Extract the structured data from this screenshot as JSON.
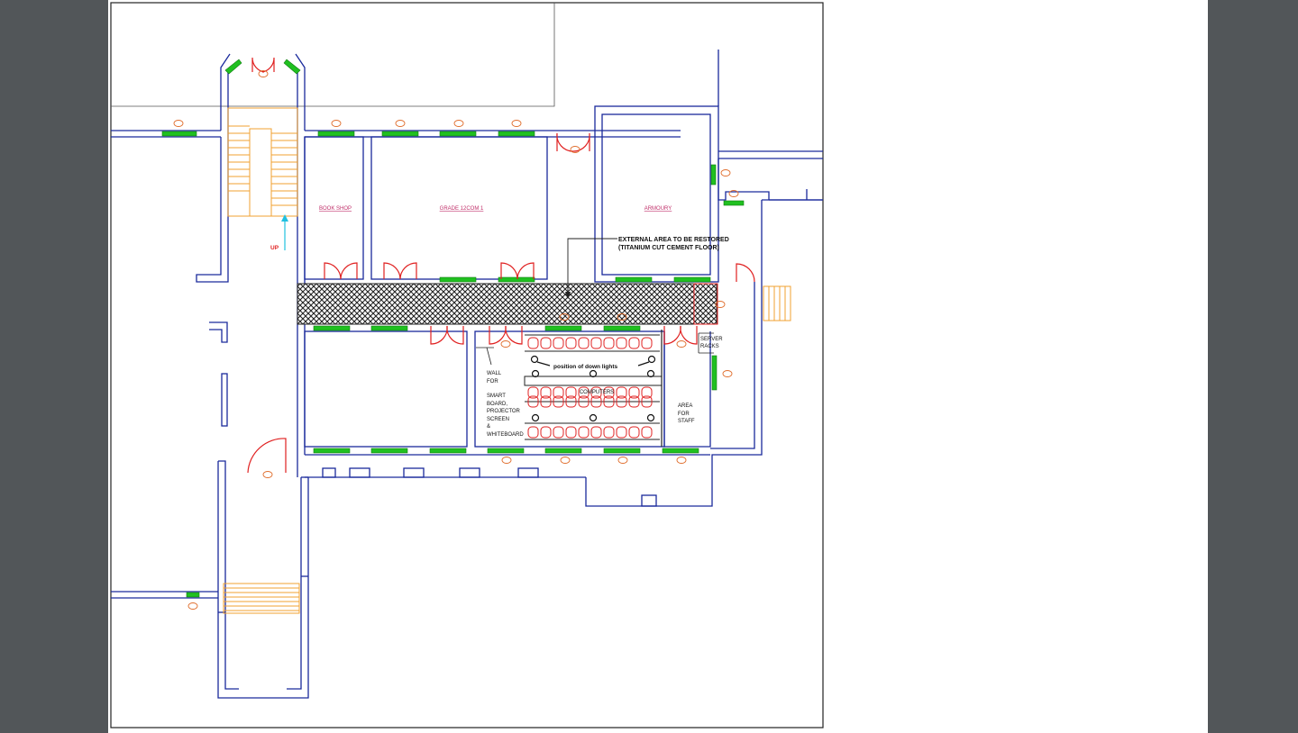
{
  "viewer": {
    "background_color": "#525659",
    "page_color": "#ffffff"
  },
  "colors": {
    "wall": "#1a2a9c",
    "window": "#20c020",
    "door": "#e02020",
    "stair": "#f0a030",
    "marker": "#e07030",
    "label": "#c0306a"
  },
  "rooms": {
    "book_shop": "BOOK SHOP",
    "grade_room": "GRADE 12COM 1",
    "armoury": "ARMOURY"
  },
  "annotations": {
    "external_line1": "EXTERNAL AREA TO BE RESTORED",
    "external_line2": "(TITANIUM CUT CEMENT FLOOR)",
    "up": "UP",
    "server_line1": "SERVER",
    "server_line2": "RACKS",
    "down_lights": "position of down lights",
    "computers": "COMPUTERS",
    "wall_lines": [
      "WALL",
      "FOR",
      "SMART",
      "BOARD,",
      "PROJECTOR",
      "SCREEN",
      "&",
      "WHITEBOARD"
    ],
    "staff_lines": [
      "AREA",
      "FOR",
      "STAFF"
    ]
  }
}
